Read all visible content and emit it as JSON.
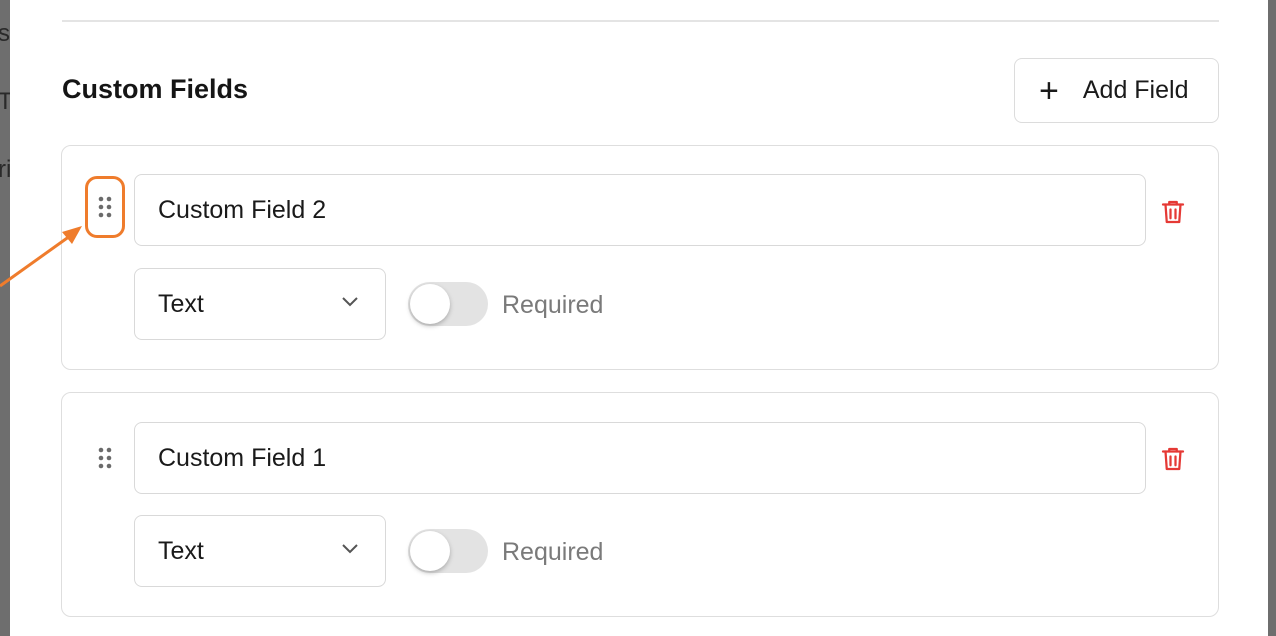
{
  "backdrop": {
    "partial_texts": [
      "s",
      "T",
      "ri"
    ]
  },
  "section": {
    "title": "Custom Fields",
    "add_button": {
      "icon": "plus-icon",
      "label": "Add Field"
    }
  },
  "fields": [
    {
      "name": "Custom Field 2",
      "type": "Text",
      "required_label": "Required",
      "required": false,
      "drag_highlighted": true
    },
    {
      "name": "Custom Field 1",
      "type": "Text",
      "required_label": "Required",
      "required": false,
      "drag_highlighted": false
    }
  ],
  "colors": {
    "annotation": "#ef7c2c",
    "delete": "#e53935",
    "toggle_off": "#e3e3e3"
  }
}
